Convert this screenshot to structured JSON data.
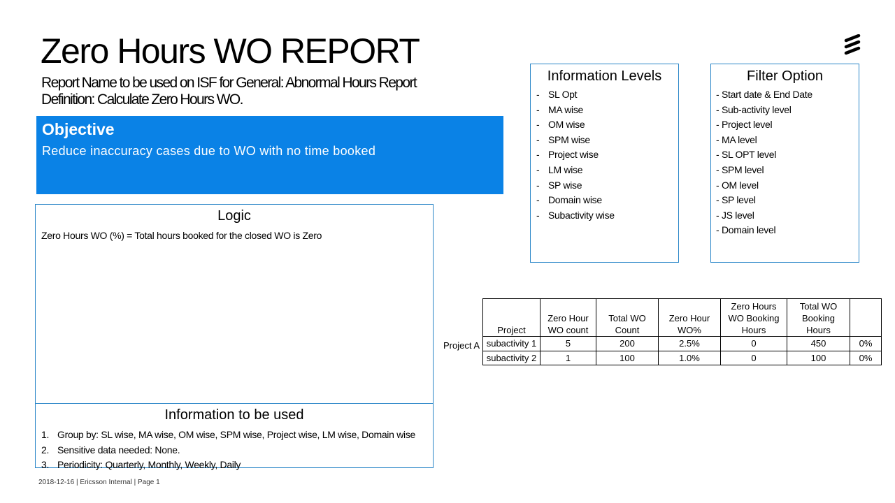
{
  "header": {
    "title": "Zero Hours WO REPORT",
    "subtitle_1": "Report Name to be used on ISF for General: Abnormal Hours Report",
    "subtitle_2": "Definition: Calculate Zero Hours WO."
  },
  "objective": {
    "heading": "Objective",
    "text": "Reduce inaccuracy cases due to WO with no time booked"
  },
  "logic": {
    "heading": "Logic",
    "text": "Zero Hours WO (%) = Total hours booked for the closed WO is Zero"
  },
  "info_to_use": {
    "heading": "Information to be used",
    "items": [
      {
        "num": "1.",
        "text": "Group by: SL wise, MA wise, OM wise, SPM wise, Project wise, LM wise, Domain wise"
      },
      {
        "num": "2.",
        "text": "Sensitive data needed: None."
      },
      {
        "num": "3.",
        "text": "Periodicity: Quarterly, Monthly, Weekly, Daily"
      }
    ]
  },
  "info_levels": {
    "heading": "Information Levels",
    "bullet": "-",
    "items": [
      "SL Opt",
      "MA wise",
      "OM wise",
      "SPM wise",
      "Project wise",
      "LM wise",
      "SP wise",
      "Domain wise",
      "Subactivity wise"
    ]
  },
  "filter_option": {
    "heading": "Filter Option",
    "items": [
      "- Start date & End Date",
      "- Sub-activity level",
      "- Project level",
      "- MA level",
      "- SL OPT level",
      "- SPM level",
      "- OM level",
      "- SP level",
      "- JS level",
      "- Domain level"
    ]
  },
  "table": {
    "row_group_label": "Project A",
    "headers": [
      "Project",
      "Zero Hour WO count",
      "Total WO Count",
      "Zero Hour WO%",
      "Zero Hours WO  Booking Hours",
      "Total WO Booking Hours",
      ""
    ],
    "rows": [
      [
        "subactivity 1",
        "5",
        "200",
        "2.5%",
        "0",
        "450",
        "0%"
      ],
      [
        "subactivity 2",
        "1",
        "100",
        "1.0%",
        "0",
        "100",
        "0%"
      ]
    ]
  },
  "footer": {
    "date": "2018-12-16",
    "classification": "Ericsson Internal",
    "page": "Page 1"
  }
}
